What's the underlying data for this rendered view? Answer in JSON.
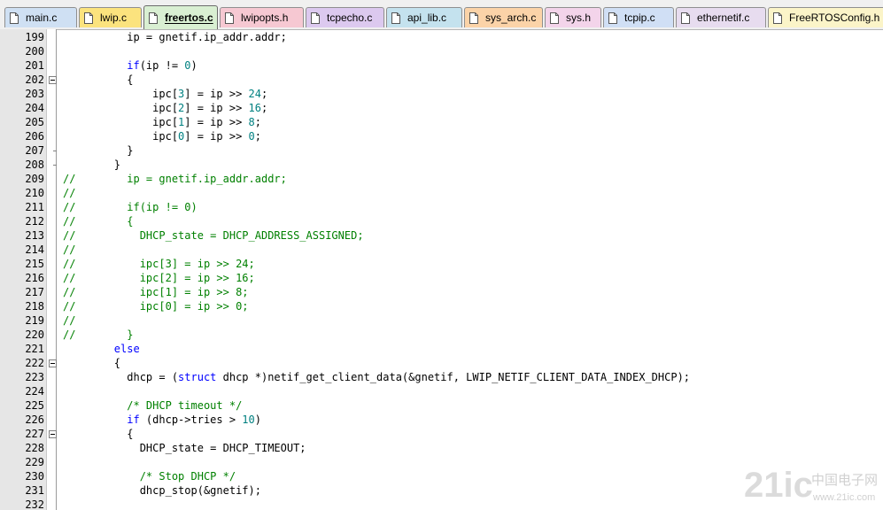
{
  "tabs": [
    {
      "label": "main.c",
      "color": "#cfe0f3",
      "icon": "c-file-icon"
    },
    {
      "label": "lwip.c",
      "color": "#fbe37e",
      "icon": "c-file-icon"
    },
    {
      "label": "freertos.c",
      "color": "#d9efd2",
      "icon": "c-file-icon",
      "active": true
    },
    {
      "label": "lwipopts.h",
      "color": "#f6c8d2",
      "icon": "h-file-icon"
    },
    {
      "label": "tcpecho.c",
      "color": "#dcc9ef",
      "icon": "c-file-icon"
    },
    {
      "label": "api_lib.c",
      "color": "#c4e2ee",
      "icon": "c-file-icon"
    },
    {
      "label": "sys_arch.c",
      "color": "#fbd3a8",
      "icon": "c-file-icon"
    },
    {
      "label": "sys.h",
      "color": "#f3d4ea",
      "icon": "h-file-icon"
    },
    {
      "label": "tcpip.c",
      "color": "#d0dff5",
      "icon": "c-file-icon"
    },
    {
      "label": "ethernetif.c",
      "color": "#e7dcef",
      "icon": "c-file-icon"
    },
    {
      "label": "FreeRTOSConfig.h",
      "color": "#fbf4c8",
      "icon": "h-file-icon"
    }
  ],
  "colors": {
    "keyword": "#0000ff",
    "number": "#008080",
    "comment": "#008000",
    "gutter": "#e6e6e6"
  },
  "lines": [
    {
      "n": "199",
      "fold": "",
      "segs": [
        [
          "t",
          "          ip = gnetif.ip_addr.addr;"
        ]
      ]
    },
    {
      "n": "200",
      "fold": "",
      "segs": []
    },
    {
      "n": "201",
      "fold": "",
      "segs": [
        [
          "t",
          "          "
        ],
        [
          "kw",
          "if"
        ],
        [
          "t",
          "(ip != "
        ],
        [
          "num",
          "0"
        ],
        [
          "t",
          ")"
        ]
      ]
    },
    {
      "n": "202",
      "fold": "open",
      "segs": [
        [
          "t",
          "          {"
        ]
      ]
    },
    {
      "n": "203",
      "fold": "",
      "segs": [
        [
          "t",
          "              ipc["
        ],
        [
          "num",
          "3"
        ],
        [
          "t",
          "] = ip >> "
        ],
        [
          "num",
          "24"
        ],
        [
          "t",
          ";"
        ]
      ]
    },
    {
      "n": "204",
      "fold": "",
      "segs": [
        [
          "t",
          "              ipc["
        ],
        [
          "num",
          "2"
        ],
        [
          "t",
          "] = ip >> "
        ],
        [
          "num",
          "16"
        ],
        [
          "t",
          ";"
        ]
      ]
    },
    {
      "n": "205",
      "fold": "",
      "segs": [
        [
          "t",
          "              ipc["
        ],
        [
          "num",
          "1"
        ],
        [
          "t",
          "] = ip >> "
        ],
        [
          "num",
          "8"
        ],
        [
          "t",
          ";"
        ]
      ]
    },
    {
      "n": "206",
      "fold": "",
      "segs": [
        [
          "t",
          "              ipc["
        ],
        [
          "num",
          "0"
        ],
        [
          "t",
          "] = ip >> "
        ],
        [
          "num",
          "0"
        ],
        [
          "t",
          ";"
        ]
      ]
    },
    {
      "n": "207",
      "fold": "end",
      "segs": [
        [
          "t",
          "          }"
        ]
      ]
    },
    {
      "n": "208",
      "fold": "end",
      "segs": [
        [
          "t",
          "        }"
        ]
      ]
    },
    {
      "n": "209",
      "fold": "",
      "segs": [
        [
          "cm",
          "//        ip = gnetif.ip_addr.addr;"
        ]
      ]
    },
    {
      "n": "210",
      "fold": "",
      "segs": [
        [
          "cm",
          "//"
        ]
      ]
    },
    {
      "n": "211",
      "fold": "",
      "segs": [
        [
          "cm",
          "//        if(ip != 0)"
        ]
      ]
    },
    {
      "n": "212",
      "fold": "",
      "segs": [
        [
          "cm",
          "//        {"
        ]
      ]
    },
    {
      "n": "213",
      "fold": "",
      "segs": [
        [
          "cm",
          "//          DHCP_state = DHCP_ADDRESS_ASSIGNED;"
        ]
      ]
    },
    {
      "n": "214",
      "fold": "",
      "segs": [
        [
          "cm",
          "//"
        ]
      ]
    },
    {
      "n": "215",
      "fold": "",
      "segs": [
        [
          "cm",
          "//          ipc[3] = ip >> 24;"
        ]
      ]
    },
    {
      "n": "216",
      "fold": "",
      "segs": [
        [
          "cm",
          "//          ipc[2] = ip >> 16;"
        ]
      ]
    },
    {
      "n": "217",
      "fold": "",
      "segs": [
        [
          "cm",
          "//          ipc[1] = ip >> 8;"
        ]
      ]
    },
    {
      "n": "218",
      "fold": "",
      "segs": [
        [
          "cm",
          "//          ipc[0] = ip >> 0;"
        ]
      ]
    },
    {
      "n": "219",
      "fold": "",
      "segs": [
        [
          "cm",
          "//"
        ]
      ]
    },
    {
      "n": "220",
      "fold": "",
      "segs": [
        [
          "cm",
          "//        }"
        ]
      ]
    },
    {
      "n": "221",
      "fold": "",
      "segs": [
        [
          "t",
          "        "
        ],
        [
          "kw",
          "else"
        ]
      ]
    },
    {
      "n": "222",
      "fold": "open",
      "segs": [
        [
          "t",
          "        {"
        ]
      ]
    },
    {
      "n": "223",
      "fold": "",
      "segs": [
        [
          "t",
          "          dhcp = ("
        ],
        [
          "kw",
          "struct"
        ],
        [
          "t",
          " dhcp *)netif_get_client_data(&gnetif, LWIP_NETIF_CLIENT_DATA_INDEX_DHCP);"
        ]
      ]
    },
    {
      "n": "224",
      "fold": "",
      "segs": []
    },
    {
      "n": "225",
      "fold": "",
      "segs": [
        [
          "t",
          "          "
        ],
        [
          "cm",
          "/* DHCP timeout */"
        ]
      ]
    },
    {
      "n": "226",
      "fold": "",
      "segs": [
        [
          "t",
          "          "
        ],
        [
          "kw",
          "if"
        ],
        [
          "t",
          " (dhcp->tries > "
        ],
        [
          "num",
          "10"
        ],
        [
          "t",
          ")"
        ]
      ]
    },
    {
      "n": "227",
      "fold": "open",
      "segs": [
        [
          "t",
          "          {"
        ]
      ]
    },
    {
      "n": "228",
      "fold": "",
      "segs": [
        [
          "t",
          "            DHCP_state = DHCP_TIMEOUT;"
        ]
      ]
    },
    {
      "n": "229",
      "fold": "",
      "segs": []
    },
    {
      "n": "230",
      "fold": "",
      "segs": [
        [
          "t",
          "            "
        ],
        [
          "cm",
          "/* Stop DHCP */"
        ]
      ]
    },
    {
      "n": "231",
      "fold": "",
      "segs": [
        [
          "t",
          "            dhcp_stop(&gnetif);"
        ]
      ]
    },
    {
      "n": "232",
      "fold": "",
      "segs": []
    }
  ],
  "watermark": {
    "brand": "21ic",
    "cn": "中国电子网",
    "url": "www.21ic.com"
  }
}
